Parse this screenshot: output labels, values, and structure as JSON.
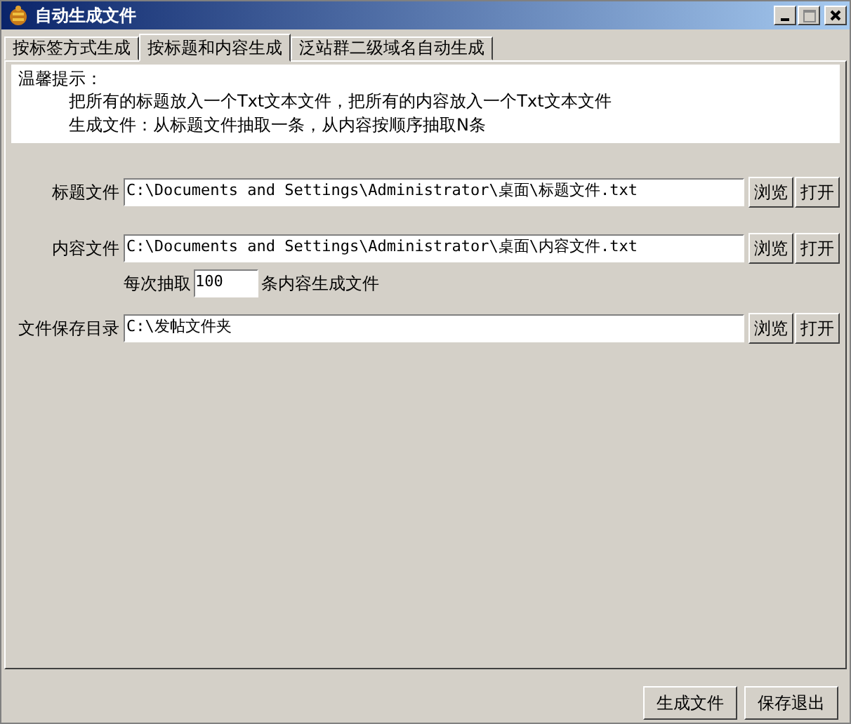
{
  "window": {
    "title": "自动生成文件"
  },
  "tabs": [
    {
      "label": "按标签方式生成",
      "selected": false
    },
    {
      "label": "按标题和内容生成",
      "selected": true
    },
    {
      "label": "泛站群二级域名自动生成",
      "selected": false
    }
  ],
  "tip": {
    "heading": "温馨提示：",
    "lines": [
      "把所有的标题放入一个Txt文本文件，把所有的内容放入一个Txt文本文件",
      "生成文件：从标题文件抽取一条，从内容按顺序抽取N条"
    ]
  },
  "rows": [
    {
      "kind": "path",
      "label": "标题文件",
      "value": "C:\\Documents and Settings\\Administrator\\桌面\\标题文件.txt",
      "buttons": [
        "浏览",
        "打开"
      ]
    },
    {
      "kind": "path",
      "label": "内容文件",
      "value": "C:\\Documents and Settings\\Administrator\\桌面\\内容文件.txt",
      "buttons": [
        "浏览",
        "打开"
      ]
    },
    {
      "kind": "count",
      "prefix": "每次抽取",
      "value": "100",
      "suffix": "条内容生成文件"
    },
    {
      "kind": "path",
      "label": "文件保存目录",
      "value": "C:\\发帖文件夹",
      "buttons": [
        "浏览",
        "打开"
      ]
    }
  ],
  "footer_buttons": [
    "生成文件",
    "保存退出"
  ]
}
